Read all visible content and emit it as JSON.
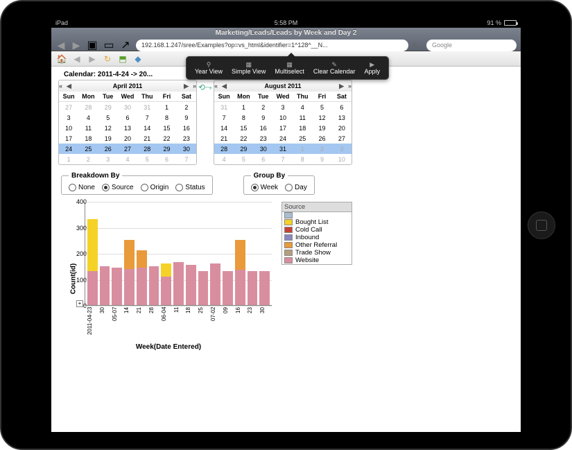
{
  "status": {
    "device": "iPad",
    "wifi": "wifi-icon",
    "time": "5:58 PM",
    "battery_pct": "91 %"
  },
  "browser": {
    "tab_title": "Marketing/Leads/Leads by Week and Day 2",
    "url": "192.168.1.247/sree/Examples?op=vs_html&identifier=1^128^__N...",
    "search_placeholder": "Google"
  },
  "dark_menu": {
    "year_view": "Year View",
    "simple_view": "Simple View",
    "multiselect": "Multiselect",
    "clear_calendar": "Clear Calendar",
    "apply": "Apply"
  },
  "calendar_title": "Calendar: 2011-4-24 -> 20...",
  "dow": [
    "Sun",
    "Mon",
    "Tue",
    "Wed",
    "Thu",
    "Fri",
    "Sat"
  ],
  "cal_left": {
    "title": "April 2011",
    "cells": [
      {
        "n": "27",
        "o": 1
      },
      {
        "n": "28",
        "o": 1
      },
      {
        "n": "29",
        "o": 1
      },
      {
        "n": "30",
        "o": 1
      },
      {
        "n": "31",
        "o": 1
      },
      {
        "n": "1"
      },
      {
        "n": "2"
      },
      {
        "n": "3"
      },
      {
        "n": "4"
      },
      {
        "n": "5"
      },
      {
        "n": "6"
      },
      {
        "n": "7"
      },
      {
        "n": "8"
      },
      {
        "n": "9"
      },
      {
        "n": "10"
      },
      {
        "n": "11"
      },
      {
        "n": "12"
      },
      {
        "n": "13"
      },
      {
        "n": "14"
      },
      {
        "n": "15"
      },
      {
        "n": "16"
      },
      {
        "n": "17"
      },
      {
        "n": "18"
      },
      {
        "n": "19"
      },
      {
        "n": "20"
      },
      {
        "n": "21"
      },
      {
        "n": "22"
      },
      {
        "n": "23"
      },
      {
        "n": "24",
        "s": 1
      },
      {
        "n": "25",
        "s": 1
      },
      {
        "n": "26",
        "s": 1
      },
      {
        "n": "27",
        "s": 1
      },
      {
        "n": "28",
        "s": 1
      },
      {
        "n": "29",
        "s": 1
      },
      {
        "n": "30",
        "s": 1
      },
      {
        "n": "1",
        "o": 1
      },
      {
        "n": "2",
        "o": 1
      },
      {
        "n": "3",
        "o": 1
      },
      {
        "n": "4",
        "o": 1
      },
      {
        "n": "5",
        "o": 1
      },
      {
        "n": "6",
        "o": 1
      },
      {
        "n": "7",
        "o": 1
      }
    ]
  },
  "cal_right": {
    "title": "August 2011",
    "cells": [
      {
        "n": "31",
        "o": 1
      },
      {
        "n": "1"
      },
      {
        "n": "2"
      },
      {
        "n": "3"
      },
      {
        "n": "4"
      },
      {
        "n": "5"
      },
      {
        "n": "6"
      },
      {
        "n": "7"
      },
      {
        "n": "8"
      },
      {
        "n": "9"
      },
      {
        "n": "10"
      },
      {
        "n": "11"
      },
      {
        "n": "12"
      },
      {
        "n": "13"
      },
      {
        "n": "14"
      },
      {
        "n": "15"
      },
      {
        "n": "16"
      },
      {
        "n": "17"
      },
      {
        "n": "18"
      },
      {
        "n": "19"
      },
      {
        "n": "20"
      },
      {
        "n": "21"
      },
      {
        "n": "22"
      },
      {
        "n": "23"
      },
      {
        "n": "24"
      },
      {
        "n": "25"
      },
      {
        "n": "26"
      },
      {
        "n": "27"
      },
      {
        "n": "28",
        "s": 1
      },
      {
        "n": "29",
        "s": 1
      },
      {
        "n": "30",
        "s": 1
      },
      {
        "n": "31",
        "s": 1
      },
      {
        "n": "1",
        "o": 1,
        "s": 1
      },
      {
        "n": "2",
        "o": 1,
        "s": 1
      },
      {
        "n": "3",
        "o": 1,
        "s": 1
      },
      {
        "n": "4",
        "o": 1
      },
      {
        "n": "5",
        "o": 1
      },
      {
        "n": "6",
        "o": 1
      },
      {
        "n": "7",
        "o": 1
      },
      {
        "n": "8",
        "o": 1
      },
      {
        "n": "9",
        "o": 1
      },
      {
        "n": "10",
        "o": 1
      }
    ]
  },
  "breakdown": {
    "legend": "Breakdown By",
    "options": {
      "none": "None",
      "source": "Source",
      "origin": "Origin",
      "status": "Status"
    },
    "selected": "source"
  },
  "groupby": {
    "legend": "Group By",
    "options": {
      "week": "Week",
      "day": "Day"
    },
    "selected": "week"
  },
  "legend_box": {
    "title": "Source",
    "items": [
      {
        "label": "",
        "class": "c-empty"
      },
      {
        "label": "Bought List",
        "class": "c-bought"
      },
      {
        "label": "Cold Call",
        "class": "c-cold"
      },
      {
        "label": "Inbound",
        "class": "c-inb"
      },
      {
        "label": "Other Referral",
        "class": "c-ref"
      },
      {
        "label": "Trade Show",
        "class": "c-trade"
      },
      {
        "label": "Website",
        "class": "c-web"
      }
    ]
  },
  "chart_data": {
    "type": "bar",
    "title": "",
    "xlabel": "Week(Date Entered)",
    "ylabel": "Count(id)",
    "ylim": [
      0,
      400
    ],
    "yticks": [
      0,
      100,
      200,
      300,
      400
    ],
    "categories": [
      "2011-04-23",
      "30",
      "05-07",
      "14",
      "21",
      "28",
      "06-04",
      "11",
      "18",
      "25",
      "07-02",
      "09",
      "16",
      "23",
      "30"
    ],
    "series_order": [
      "Website",
      "Trade Show",
      "Other Referral",
      "Inbound",
      "Cold Call",
      "Bought List",
      ""
    ],
    "stacks": [
      {
        "Website": 130,
        "Bought List": 200
      },
      {
        "Website": 150
      },
      {
        "Website": 145
      },
      {
        "Website": 140,
        "Other Referral": 110
      },
      {
        "Website": 145,
        "Other Referral": 65
      },
      {
        "Website": 150
      },
      {
        "Website": 110,
        "Bought List": 50
      },
      {
        "Website": 165
      },
      {
        "Website": 155
      },
      {
        "Website": 130
      },
      {
        "Website": 160
      },
      {
        "Website": 130
      },
      {
        "Website": 135,
        "Other Referral": 115
      },
      {
        "Website": 130
      },
      {
        "Website": 130
      }
    ]
  }
}
